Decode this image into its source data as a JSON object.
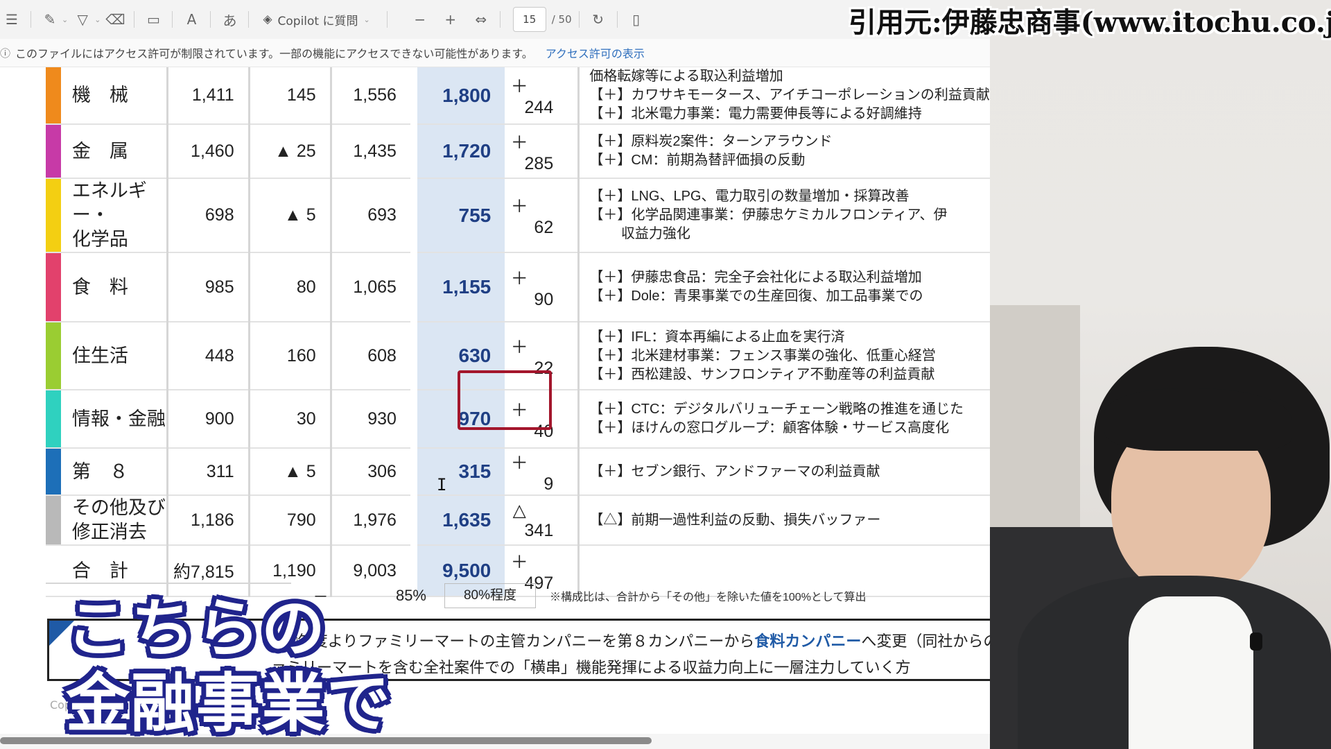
{
  "toolbar": {
    "copilot_label": "Copilot に質問",
    "page_current": "15",
    "page_total": "/ 50"
  },
  "notice": {
    "text": "このファイルにはアクセス許可が制限されています。一部の機能にアクセスできない可能性があります。",
    "link": "アクセス許可の表示"
  },
  "table": {
    "rows": [
      {
        "name": "機　械",
        "color": "#ef8a1c",
        "c1": "1,411",
        "c2": "145",
        "c3": "1,556",
        "plan": "1,800",
        "sign": "＋",
        "diff": "244",
        "comments": [
          "価格転嫁等による取込利益増加",
          "【＋】カワサキモータース、アイチコーポレーションの利益貢献",
          "【＋】北米電力事業：電力需要伸長等による好調維持"
        ]
      },
      {
        "name": "金　属",
        "color": "#c73aa7",
        "c1": "1,460",
        "c2": "▲ 25",
        "c3": "1,435",
        "plan": "1,720",
        "sign": "＋",
        "diff": "285",
        "comments": [
          "【＋】原料炭2案件：ターンアラウンド",
          "【＋】CM：前期為替評価損の反動"
        ]
      },
      {
        "name": "エネルギー・\n化学品",
        "color": "#f3cf12",
        "c1": "698",
        "c2": "▲ 5",
        "c3": "693",
        "plan": "755",
        "sign": "＋",
        "diff": "62",
        "comments": [
          "【＋】LNG、LPG、電力取引の数量増加・採算改善",
          "【＋】化学品関連事業：伊藤忠ケミカルフロンティア、伊",
          "　　 収益力強化"
        ]
      },
      {
        "name": "食　料",
        "color": "#e2416c",
        "c1": "985",
        "c2": "80",
        "c3": "1,065",
        "plan": "1,155",
        "sign": "＋",
        "diff": "90",
        "comments": [
          "【＋】伊藤忠食品：完全子会社化による取込利益増加",
          "【＋】Dole：青果事業での生産回復、加工品事業での"
        ]
      },
      {
        "name": "住生活",
        "color": "#9acd32",
        "c1": "448",
        "c2": "160",
        "c3": "608",
        "plan": "630",
        "sign": "＋",
        "diff": "22",
        "comments": [
          "【＋】IFL：資本再編による止血を実行済",
          "【＋】北米建材事業：フェンス事業の強化、低重心経営",
          "【＋】西松建設、サンフロンティア不動産等の利益貢献"
        ]
      },
      {
        "name": "情報・金融",
        "color": "#2fd1bf",
        "c1": "900",
        "c2": "30",
        "c3": "930",
        "plan": "970",
        "sign": "＋",
        "diff": "40",
        "comments": [
          "【＋】CTC：デジタルバリューチェーン戦略の推進を通じた",
          "【＋】ほけんの窓口グループ：顧客体験・サービス高度化"
        ]
      },
      {
        "name": "第　８",
        "color": "#1d6fb8",
        "c1": "311",
        "c2": "▲ 5",
        "c3": "306",
        "plan": "315",
        "sign": "＋",
        "diff": "9",
        "comments": [
          "【＋】セブン銀行、アンドファーマの利益貢献"
        ]
      },
      {
        "name": "その他及び\n修正消去",
        "color": "#b9b9b9",
        "c1": "1,186",
        "c2": "790",
        "c3": "1,976",
        "plan": "1,635",
        "sign": "△",
        "diff": "341",
        "comments": [
          "【△】前期一過性利益の反動、損失バッファー"
        ]
      },
      {
        "name": "合　計",
        "color": "#ffffff",
        "c1": "約7,815",
        "c2": "1,190",
        "c3": "9,003",
        "plan": "9,500",
        "sign": "＋",
        "diff": "497",
        "comments": []
      }
    ]
  },
  "ratio": {
    "c2": "－",
    "c3": "85%",
    "c4": "80%程度",
    "note": "※構成比は、合計から「その他」を除いた値を100%として算出"
  },
  "footnote": {
    "line1_pre": "20□年度よりファミリーマートの主管カンパニーを第８カンパニーから",
    "line1_blue": "食料カンパニー",
    "line1_post": "へ変更（同社からの取込損益は食",
    "line2": "ァミリーマートを含む全社案件での「横串」機能発揮による収益力向上に一層注力していく方",
    "copyright": "Cop                                                             ed"
  },
  "source": "引用元:伊藤忠商事(www.itochu.co.jp)",
  "caption": {
    "line1": "こちらの",
    "line2": "金融事業で"
  },
  "colors": {
    "highlight_border": "#a3162c",
    "plan_bg": "#dbe6f3",
    "plan_text": "#1f3f84",
    "caption_outline": "#20248c"
  }
}
